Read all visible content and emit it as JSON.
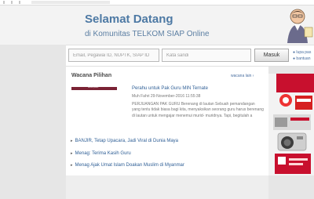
{
  "hero": {
    "title": "Selamat Datang",
    "subtitle": "di Komunitas TELKOM SIAP Online"
  },
  "login": {
    "user_placeholder": "Email, Pegawai ID, NUPTK, SIAP ID",
    "password_placeholder": "Kata sandi",
    "button_label": "Masuk",
    "forgot_line1": "lupa pas",
    "forgot_line2": "bantuan"
  },
  "section": {
    "title": "Wacana Pilihan",
    "more_label": "wacana lain"
  },
  "featured": {
    "thumbnail_label": "wacana pilihan",
    "title": "Perahu untuk Pak Guru MIN Ternate",
    "meta": "Muh Fahri 29-November-2016 11:55:38",
    "excerpt": "PERJUANGAN PAK GURU Berenang di lautan Sebuah pemandangan yang tentu tidak biasa bagi kita, menyaksikan seorang guru harus berenang di lautan untuk mengajar menemui murid- muridnya. Tapi, begitulah a"
  },
  "articles": [
    {
      "title": "BANJIR, Tetap Upacara, Jadi Viral di Dunia Maya"
    },
    {
      "title": "Menag: Terima Kasih Guru"
    },
    {
      "title": "Menag Ajak Umat Islam Doakan Muslim di Myanmar"
    }
  ],
  "colors": {
    "accent_blue": "#4d79a4",
    "link_blue": "#2f5f96",
    "thumbnail_maroon": "#7a2234",
    "ad_red": "#c8102e"
  },
  "icons": {
    "bullet": "triangle-right-icon",
    "mascot": "teacher-mascot-icon"
  }
}
